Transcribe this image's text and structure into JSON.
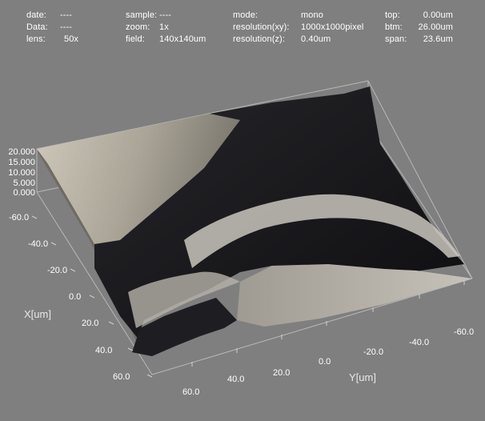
{
  "meta": {
    "date_label": "date:",
    "date_value": "----",
    "data_label": "Data:",
    "data_value": "----",
    "lens_label": "lens:",
    "lens_value": "50x",
    "sample_label": "sample:",
    "sample_value": "----",
    "zoom_label": "zoom:",
    "zoom_value": "1x",
    "field_label": "field:",
    "field_value": "140x140um",
    "mode_label": "mode:",
    "mode_value": "mono",
    "res_xy_label": "resolution(xy):",
    "res_xy_value": "1000x1000pixel",
    "res_z_label": "resolution(z):",
    "res_z_value": "0.40um",
    "top_label": "top:",
    "top_value": "0.00um",
    "btm_label": "btm:",
    "btm_value": "26.00um",
    "span_label": "span:",
    "span_value": "23.6um"
  },
  "plot": {
    "z_ticks": [
      "20.000",
      "15.000",
      "10.000",
      "5.000",
      "0.000"
    ],
    "x_axis_title": "X[um]",
    "x_ticks": [
      "-60.0",
      "-40.0",
      "-20.0",
      "0.0",
      "20.0",
      "40.0",
      "60.0"
    ],
    "y_axis_title": "Y[um]",
    "y_ticks": [
      "60.0",
      "40.0",
      "20.0",
      "0.0",
      "-20.0",
      "-40.0",
      "-60.0"
    ]
  }
}
